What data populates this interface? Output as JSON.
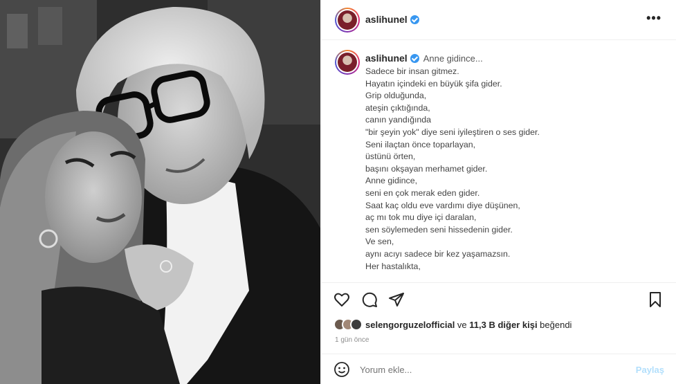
{
  "header": {
    "username": "aslihunel",
    "avatar_icon": "profile-avatar",
    "verified_icon": "verified-badge-icon",
    "more_icon": "more-options-icon",
    "more_label": "•••"
  },
  "caption": {
    "username": "aslihunel",
    "first_line": "Anne gidince...",
    "lines": [
      "Sadece bir insan gitmez.",
      "Hayatın içindeki en büyük şifa gider.",
      "Grip olduğunda,",
      "ateşin çıktığında,",
      "canın yandığında",
      "\"bir şeyin yok\" diye seni iyileştiren o ses gider.",
      "Seni ilaçtan önce toparlayan,",
      "üstünü örten,",
      "başını okşayan merhamet gider.",
      "Anne gidince,",
      "seni en çok merak eden gider.",
      "Saat kaç oldu eve vardımı diye düşünen,",
      "aç mı tok mu diye içi daralan,",
      "sen söylemeden seni hissedenin gider.",
      "Ve sen,",
      "aynı acıyı sadece bir kez yaşamazsın.",
      "Her hastalıkta,"
    ]
  },
  "actions": {
    "like_icon": "heart-icon",
    "comment_icon": "comment-icon",
    "share_icon": "share-icon",
    "save_icon": "bookmark-icon"
  },
  "likes": {
    "liked_by": "selengorguzelofficial",
    "connector": " ve ",
    "others": "11,3 B diğer kişi",
    "suffix": " beğendi"
  },
  "timestamp": "1 gün önce",
  "comment": {
    "emoji_icon": "emoji-icon",
    "placeholder": "Yorum ekle...",
    "post_label": "Paylaş"
  },
  "colors": {
    "verified": "#3897f0",
    "post_button_disabled": "#b2dffc",
    "muted_text": "#8e8e8e"
  }
}
